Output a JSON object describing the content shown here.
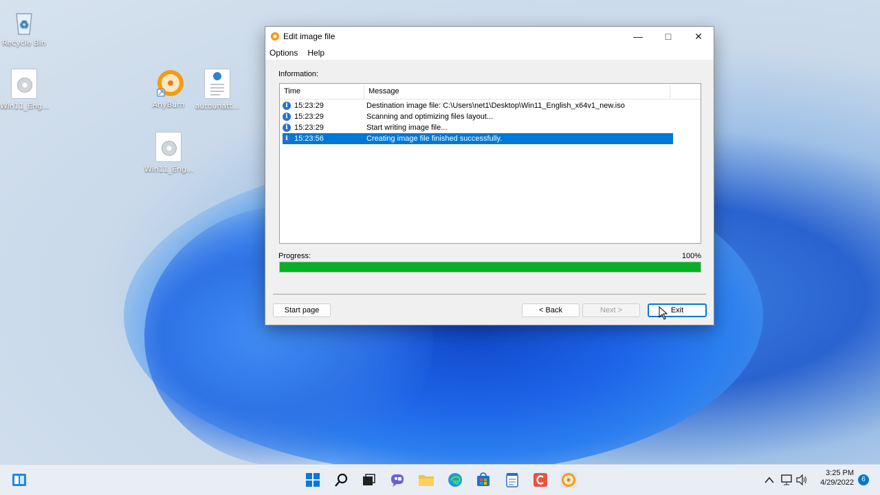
{
  "desktop": {
    "icons": [
      {
        "label": "Recycle Bin"
      },
      {
        "label": "Win11_Eng..."
      },
      {
        "label": "AnyBurn"
      },
      {
        "label": "autounatt..."
      },
      {
        "label": "Win11_Eng..."
      }
    ]
  },
  "window": {
    "title": "Edit image file",
    "menu": [
      "Options",
      "Help"
    ],
    "information_label": "Information:",
    "columns": [
      "Time",
      "Message"
    ],
    "log": [
      {
        "time": "15:23:29",
        "message": "Destination image file:  C:\\Users\\net1\\Desktop\\Win11_English_x64v1_new.iso",
        "selected": false
      },
      {
        "time": "15:23:29",
        "message": "Scanning and optimizing files layout...",
        "selected": false
      },
      {
        "time": "15:23:29",
        "message": "Start writing image file...",
        "selected": false
      },
      {
        "time": "15:23:56",
        "message": "Creating image file finished successfully.",
        "selected": true
      }
    ],
    "progress_label": "Progress:",
    "progress_text": "100%",
    "progress_value": 1.0,
    "buttons": {
      "start_page": "Start page",
      "back": "< Back",
      "next": "Next >",
      "exit": "Exit"
    }
  },
  "taskbar": {
    "time": "3:25 PM",
    "date": "4/29/2022",
    "notification_count": "6",
    "accent": "#0078d7"
  }
}
